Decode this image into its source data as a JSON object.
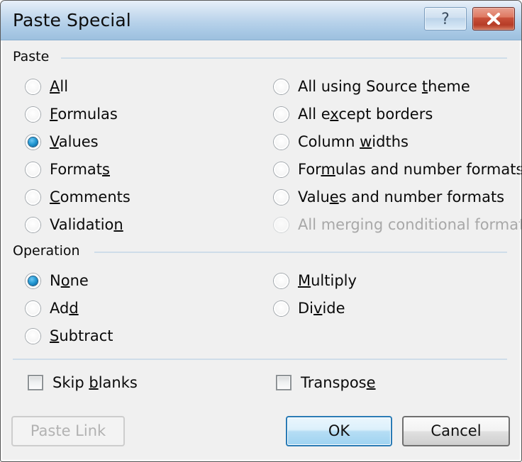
{
  "window": {
    "title": "Paste Special",
    "help_button": "?",
    "close_button": "✕",
    "accent_blue": "#2a7bb5",
    "close_red": "#b63c27",
    "titlebar_blue": "#b8d2ea",
    "dialog_bg": "#f0f0f0",
    "separator_color": "#cfdde9"
  },
  "paste_group": {
    "label": "Paste",
    "left_options": [
      {
        "label": "All",
        "accel_index": 0,
        "selected": false,
        "disabled": false
      },
      {
        "label": "Formulas",
        "accel_index": 0,
        "selected": false,
        "disabled": false
      },
      {
        "label": "Values",
        "accel_index": 0,
        "selected": true,
        "disabled": false
      },
      {
        "label": "Formats",
        "accel_index": 6,
        "selected": false,
        "disabled": false
      },
      {
        "label": "Comments",
        "accel_index": 0,
        "selected": false,
        "disabled": false
      },
      {
        "label": "Validation",
        "accel_index": 9,
        "selected": false,
        "disabled": false
      }
    ],
    "right_options": [
      {
        "label": "All using Source theme",
        "accel_index": 17,
        "selected": false,
        "disabled": false
      },
      {
        "label": "All except borders",
        "accel_index": 5,
        "selected": false,
        "disabled": false
      },
      {
        "label": "Column widths",
        "accel_index": 7,
        "selected": false,
        "disabled": false
      },
      {
        "label": "Formulas and number formats",
        "accel_index": 3,
        "selected": false,
        "disabled": false
      },
      {
        "label": "Values and number formats",
        "accel_index": 4,
        "selected": false,
        "disabled": false
      },
      {
        "label": "All merging conditional formats",
        "accel_index": -1,
        "selected": false,
        "disabled": true
      }
    ]
  },
  "operation_group": {
    "label": "Operation",
    "left_options": [
      {
        "label": "None",
        "accel_index": 1,
        "selected": true,
        "disabled": false
      },
      {
        "label": "Add",
        "accel_index": 2,
        "selected": false,
        "disabled": false
      },
      {
        "label": "Subtract",
        "accel_index": 0,
        "selected": false,
        "disabled": false
      }
    ],
    "right_options": [
      {
        "label": "Multiply",
        "accel_index": 0,
        "selected": false,
        "disabled": false
      },
      {
        "label": "Divide",
        "accel_index": 2,
        "selected": false,
        "disabled": false
      }
    ]
  },
  "checkboxes": [
    {
      "label": "Skip blanks",
      "accel_index": 5,
      "checked": false
    },
    {
      "label": "Transpose",
      "accel_index": 8,
      "checked": false
    }
  ],
  "buttons": {
    "paste_link": {
      "label": "Paste Link",
      "state": "disabled"
    },
    "ok": {
      "label": "OK",
      "state": "default"
    },
    "cancel": {
      "label": "Cancel",
      "state": "normal"
    }
  }
}
